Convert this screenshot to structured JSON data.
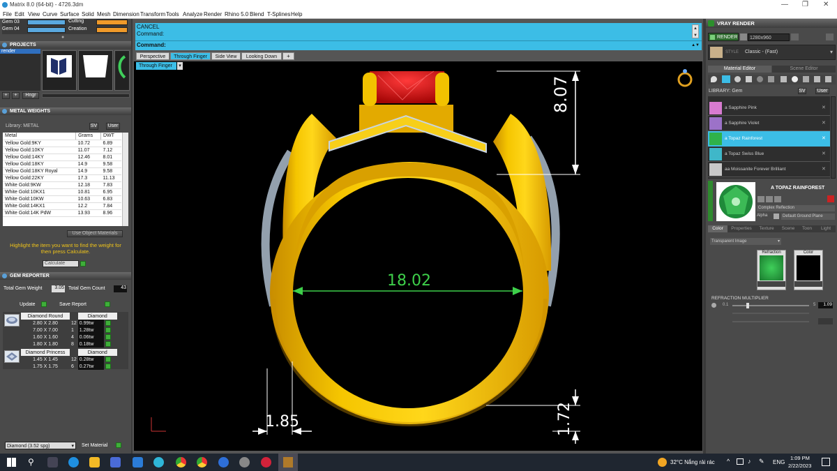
{
  "window": {
    "title": "Matrix 8.0 (64-bit) - 4726.3dm"
  },
  "menu": [
    "File",
    "Edit",
    "View",
    "Curve",
    "Surface",
    "Solid",
    "Mesh",
    "Dimension",
    "Transform",
    "Tools",
    "Analyze",
    "Render",
    "Rhino 5.0",
    "Blend",
    "T-Splines",
    "Help"
  ],
  "layers": [
    {
      "label": "Gem 03",
      "right": "Cutting"
    },
    {
      "label": "Gem 04",
      "right": "Creation"
    }
  ],
  "projects": {
    "title": "PROJECTS",
    "item": "render",
    "hinge_label": "Hngr"
  },
  "metal": {
    "title": "METAL WEIGHTS",
    "library_label": "Library: METAL",
    "unit_toggle": "SV",
    "user_label": "User",
    "columns": [
      "Metal",
      "Grams",
      "DWT"
    ],
    "rows": [
      [
        "Yellow Gold:9KY",
        "10.72",
        "6.89"
      ],
      [
        "Yellow Gold:10KY",
        "11.07",
        "7.12"
      ],
      [
        "Yellow Gold:14KY",
        "12.46",
        "8.01"
      ],
      [
        "Yellow Gold:18KY",
        "14.9",
        "9.58"
      ],
      [
        "Yellow Gold:18KY Royal",
        "14.9",
        "9.58"
      ],
      [
        "Yellow Gold:22KY",
        "17.3",
        "11.13"
      ],
      [
        "White Gold:9KW",
        "12.18",
        "7.83"
      ],
      [
        "White Gold:10KX1",
        "10.81",
        "6.95"
      ],
      [
        "White Gold:10KW",
        "10.63",
        "6.83"
      ],
      [
        "White Gold:14KX1",
        "12.2",
        "7.84"
      ],
      [
        "White Gold:14K PdW",
        "13.93",
        "8.96"
      ]
    ],
    "use_object": "Use Object Materials",
    "hint": "Highlight the item you want to find the weight for then press Calculate.",
    "calculate": "Calculate"
  },
  "gem": {
    "title": "GEM REPORTER",
    "total_weight_label": "Total Gem Weight",
    "total_weight": "3.05",
    "total_count_label": "Total Gem Count",
    "total_count": "43",
    "update": "Update",
    "save_report": "Save Report",
    "groups": [
      {
        "shape": "Diamond Round",
        "material": "Diamond",
        "rows": [
          [
            "2.80 X 2.80",
            "12",
            "0.99tw"
          ],
          [
            "7.00 X 7.00",
            "1",
            "1.28tw"
          ],
          [
            "1.60 X 1.60",
            "4",
            "0.06tw"
          ],
          [
            "1.80 X 1.80",
            "8",
            "0.18tw"
          ]
        ]
      },
      {
        "shape": "Diamond Princess",
        "material": "Diamond",
        "rows": [
          [
            "1.45 X 1.45",
            "12",
            "0.28tw"
          ],
          [
            "1.75 X 1.75",
            "6",
            "0.27tw"
          ]
        ]
      }
    ],
    "footer_select": "Diamond    (3.52 spg)",
    "set_material": "Set Material"
  },
  "command": {
    "line1": "CANCEL",
    "line2": "Command:",
    "prompt": "Command:"
  },
  "view_tabs": [
    "Perspective",
    "Through Finger",
    "Side View",
    "Looking Down",
    "+"
  ],
  "active_tab": "Through Finger",
  "viewport_label": "Through Finger",
  "dimensions": {
    "top": "8.07",
    "width": "18.02",
    "wall": "1.85",
    "bottom": "1.72"
  },
  "vray": {
    "title": "VRAY RENDER",
    "render_btn": "RENDER",
    "resolution": "1280x960",
    "preset_label": "STYLE",
    "preset": "Classic - (Fast)",
    "tabs": [
      "Material Editor",
      "Scene Editor"
    ],
    "library": "LIBRARY: Gem",
    "unit_toggle": "SV",
    "user_label": "User",
    "materials": [
      "a Sapphire Pink",
      "a Sapphire Violet",
      "a Topaz Rainforest",
      "a Topaz Swiss Blue",
      "aa Moissanite Forever Brilliant"
    ],
    "selected_index": 2,
    "selected_name": "A TOPAZ RAINFOREST",
    "complex": "Complex Reflection",
    "alpha_label": "Alpha",
    "ground": "Default Ground Plane",
    "prop_tabs": [
      "Color",
      "Properties",
      "Texture",
      "Scene",
      "Toon",
      "Light"
    ],
    "image_mode": "Transparent Image",
    "swatch_labels": [
      "Refraction",
      "Color"
    ],
    "multiplier_label": "REFRACTION MULTIPLIER",
    "mult_min": "0.1",
    "mult_max": "5",
    "mult_value": "1.09"
  },
  "tray": {
    "weather": "32°C  Nắng rải rác",
    "lang": "ENG",
    "time": "1:09 PM",
    "date": "2/22/2023"
  },
  "colors": {
    "accent": "#3cbde6",
    "gold": "#f2c200",
    "ruby": "#d41818",
    "dim_green": "#3ecf4a",
    "gem_green": "#2fb24a"
  }
}
